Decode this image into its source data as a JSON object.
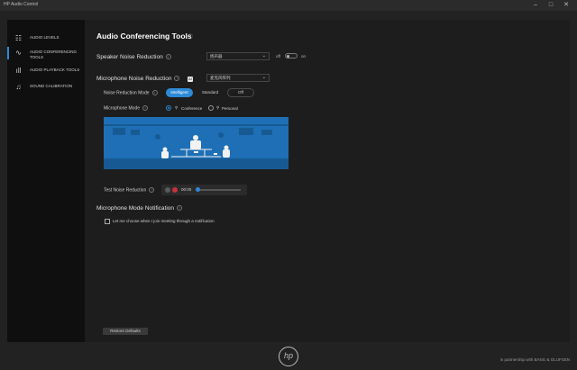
{
  "window": {
    "title": "HP Audio Control",
    "minimize": "–",
    "maximize": "□",
    "close": "✕"
  },
  "sidebar": {
    "items": [
      {
        "label": "AUDIO LEVELS",
        "icon": "sliders-icon"
      },
      {
        "label": "AUDIO CONFERENCING TOOLS",
        "icon": "waveform-icon",
        "active": true
      },
      {
        "label": "AUDIO PLAYBACK TOOLS",
        "icon": "bars-icon"
      },
      {
        "label": "SOUND CALIBRATION",
        "icon": "music-note-icon"
      }
    ]
  },
  "main": {
    "title": "Audio Conferencing Tools",
    "speaker_nr": {
      "label": "Speaker Noise Reduction",
      "device": "扬声器",
      "toggle_off": "off",
      "toggle_on": "on"
    },
    "mic_nr": {
      "label": "Microphone Noise Reduction",
      "tag": "AI",
      "device": "麦克风阵列"
    },
    "nr_mode": {
      "label": "Noise Reduction Mode",
      "options": [
        "Intelligent",
        "Standard",
        "Off"
      ],
      "selected": "Intelligent"
    },
    "mic_mode": {
      "label": "Microphone Mode",
      "options": [
        "Conference",
        "Personal"
      ],
      "selected": "Conference"
    },
    "last_nr": {
      "label": "Test Noise Reduction",
      "time": "00:00",
      "progress": 0
    },
    "notification": {
      "title": "Microphone Mode Notification",
      "checkbox_label": "Let me choose when I join meeting through a notification",
      "checked": false
    },
    "restore_button": "Restore Defaults"
  },
  "footer": {
    "logo": "hp",
    "brand": "in partnership with BANG & OLUFSEN"
  },
  "colors": {
    "accent": "#2d8ad6",
    "illustration_bg": "#1e6fb5"
  }
}
